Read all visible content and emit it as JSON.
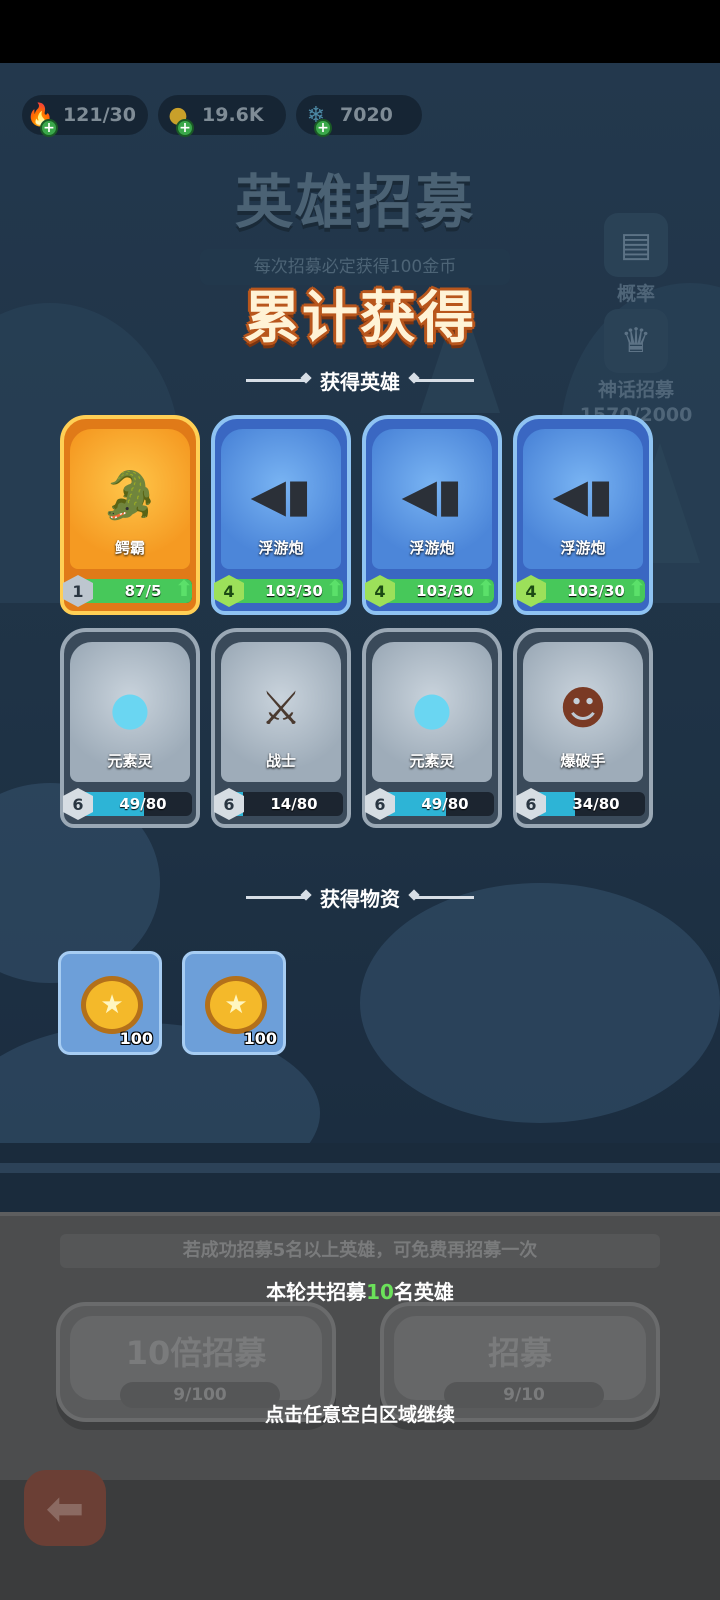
{
  "resources": [
    {
      "icon": "energy-icon",
      "value": "121/30"
    },
    {
      "icon": "gold-coin-icon",
      "value": "19.6K"
    },
    {
      "icon": "crystal-icon",
      "value": "7020"
    }
  ],
  "background": {
    "title": "英雄招募",
    "subtitle": "每次招募必定获得100金币",
    "prob_label": "概率",
    "myth_label": "神话招募",
    "myth_progress": "1570/2000"
  },
  "popup": {
    "title": "累计获得",
    "heroes_section": "获得英雄",
    "items_section": "获得物资"
  },
  "heroes": [
    {
      "name": "鳄霸",
      "level": "1",
      "progress": "87/5",
      "fill_fraction": 1.0,
      "rarity": "gold",
      "upgradable": true
    },
    {
      "name": "浮游炮",
      "level": "4",
      "progress": "103/30",
      "fill_fraction": 1.0,
      "rarity": "blue",
      "upgradable": true
    },
    {
      "name": "浮游炮",
      "level": "4",
      "progress": "103/30",
      "fill_fraction": 1.0,
      "rarity": "blue",
      "upgradable": true
    },
    {
      "name": "浮游炮",
      "level": "4",
      "progress": "103/30",
      "fill_fraction": 1.0,
      "rarity": "blue",
      "upgradable": true
    },
    {
      "name": "元素灵",
      "level": "6",
      "progress": "49/80",
      "fill_fraction": 0.61,
      "rarity": "gray",
      "upgradable": false
    },
    {
      "name": "战士",
      "level": "6",
      "progress": "14/80",
      "fill_fraction": 0.18,
      "rarity": "gray",
      "upgradable": false
    },
    {
      "name": "元素灵",
      "level": "6",
      "progress": "49/80",
      "fill_fraction": 0.61,
      "rarity": "gray",
      "upgradable": false
    },
    {
      "name": "爆破手",
      "level": "6",
      "progress": "34/80",
      "fill_fraction": 0.43,
      "rarity": "gray",
      "upgradable": false
    }
  ],
  "items": [
    {
      "icon": "gold-coin-icon",
      "quantity": "100"
    },
    {
      "icon": "gold-coin-icon",
      "quantity": "100"
    }
  ],
  "bottom": {
    "hint": "若成功招募5名以上英雄，可免费再招募一次",
    "round_prefix": "本轮共招募",
    "round_count": "10",
    "round_suffix": "名英雄",
    "btn_ten_label": "10倍招募",
    "btn_ten_cost": "9/100",
    "btn_one_label": "招募",
    "btn_one_cost": "9/10",
    "continue_text": "点击任意空白区域继续"
  },
  "colors": {
    "accent_green": "#6be15a",
    "title_orange": "#b8561c",
    "bar_green": "#47c85a",
    "bar_cyan": "#2db4d6"
  }
}
